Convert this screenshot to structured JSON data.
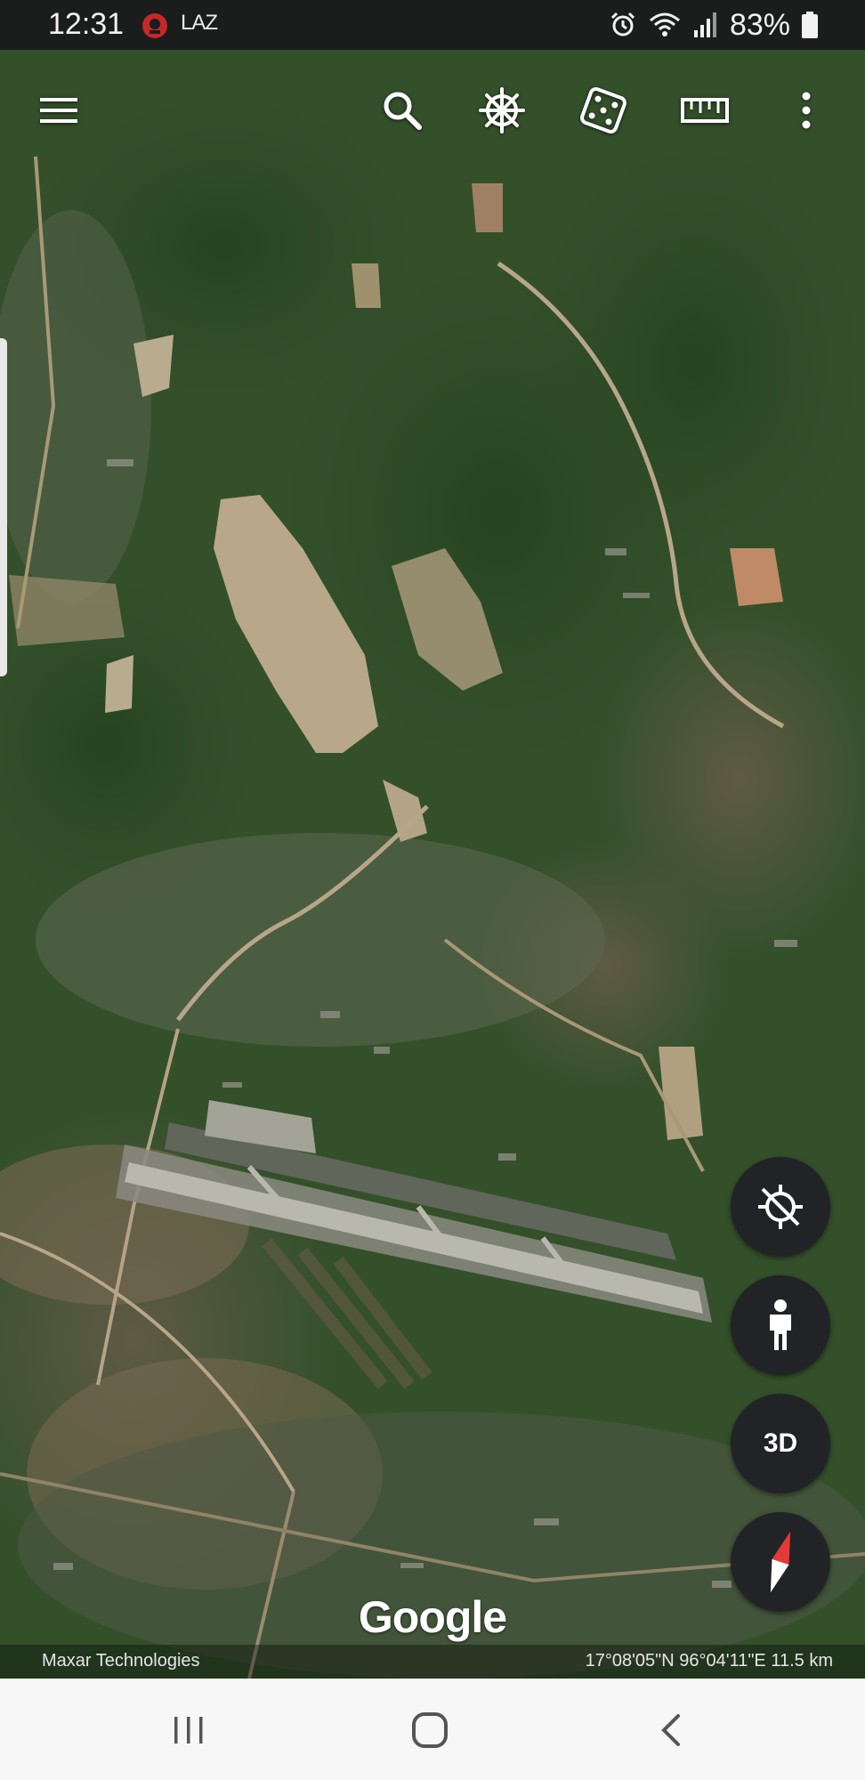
{
  "status_bar": {
    "time": "12:31",
    "app_label": "LAZ",
    "battery_percent": "83%",
    "icons": [
      "app-notification-icon",
      "alarm-icon",
      "wifi-icon",
      "signal-icon",
      "battery-icon"
    ]
  },
  "toolbar": {
    "icons": [
      "menu-icon",
      "search-icon",
      "voyager-wheel-icon",
      "feeling-lucky-dice-icon",
      "measure-ruler-icon",
      "more-options-icon"
    ]
  },
  "map_controls": {
    "location_icon": "location-off-icon",
    "street_view_icon": "pegman-icon",
    "three_d_label": "3D",
    "compass_icon": "compass-icon"
  },
  "map": {
    "logo": "Google",
    "attribution": "Maxar Technologies",
    "coordinates": "17°08'05\"N 96°04'11\"E 11.5 km"
  },
  "nav_bar": {
    "icons": [
      "recent-apps-icon",
      "home-icon",
      "back-icon"
    ]
  },
  "colors": {
    "status_bar_bg": "#1b1d1c",
    "fab_bg": "#222326",
    "compass_red": "#e53935",
    "nav_bar_bg": "#f7f7f7"
  }
}
